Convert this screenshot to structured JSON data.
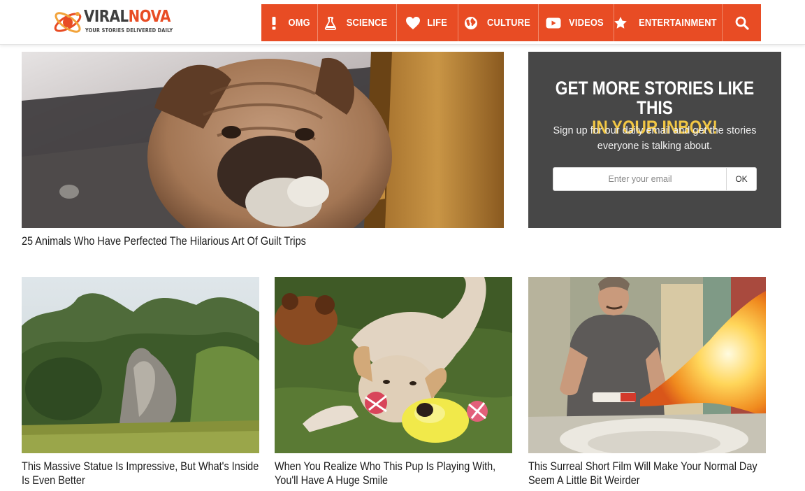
{
  "site": {
    "logo_name_1": "VIRAL",
    "logo_name_2": "NOVA",
    "tagline": "YOUR STORIES DELIVERED DAILY",
    "colors": {
      "brand": "#e84c24",
      "accent_yellow": "#f2c744",
      "newsletter_bg": "#474747"
    }
  },
  "nav": {
    "items": [
      {
        "label": "OMG",
        "icon": "exclamation-icon"
      },
      {
        "label": "SCIENCE",
        "icon": "flask-icon"
      },
      {
        "label": "LIFE",
        "icon": "heart-icon"
      },
      {
        "label": "CULTURE",
        "icon": "globe-icon"
      },
      {
        "label": "VIDEOS",
        "icon": "play-icon"
      },
      {
        "label": "ENTERTAINMENT",
        "icon": "star-icon"
      }
    ],
    "search_icon": "search-icon"
  },
  "featured": {
    "title": "25 Animals Who Have Perfected The Hilarious Art Of Guilt Trips"
  },
  "newsletter": {
    "heading_line1": "GET MORE STORIES LIKE THIS",
    "heading_line2": "IN YOUR INBOX!",
    "text": "Sign up for our daily email and get the stories everyone is talking about.",
    "input_placeholder": "Enter your email",
    "button_label": "OK"
  },
  "cards": [
    {
      "title": "This Massive Statue Is Impressive, But What's Inside Is Even Better"
    },
    {
      "title": "When You Realize Who This Pup Is Playing With, You'll Have A Huge Smile"
    },
    {
      "title": "This Surreal Short Film Will Make Your Normal Day Seem A Little Bit Weirder"
    }
  ]
}
